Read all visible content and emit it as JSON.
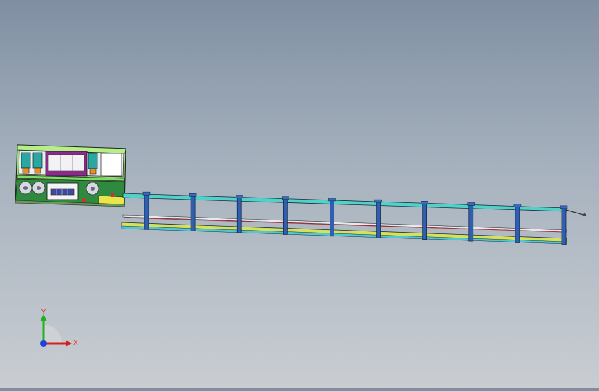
{
  "viewport": {
    "background_top": "#7f8fa2",
    "background_bottom": "#c9cdd2"
  },
  "model": {
    "machine_frame_color": "#7ddc6a",
    "panel_purple": "#8a2a8a",
    "conveyor_rail_color": "#50d2c8",
    "conveyor_post_color": "#2f5fb0",
    "conveyor_lower_rail_color": "#c8d850",
    "wire_color": "#b0303a",
    "post_count": 10
  },
  "triad": {
    "x_label": "X",
    "y_label": "Y",
    "x_color": "#d42020",
    "y_color": "#20b020",
    "z_color": "#2040e0"
  }
}
